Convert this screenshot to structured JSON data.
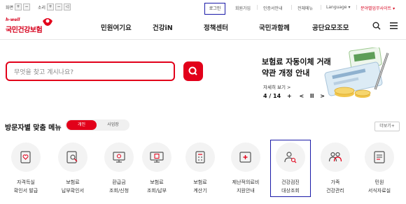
{
  "utility": {
    "screen_label": "화면",
    "sound_label": "소리",
    "plus": "+",
    "minus": "−",
    "links": [
      "로그인",
      "회원가입",
      "인증서안내",
      "전체메뉴"
    ],
    "language": "Language ▾",
    "sitemap": "분야별업무사이트 ▾"
  },
  "logo": {
    "tag": "h-well",
    "name": "국민건강보험"
  },
  "nav": [
    "민원여기요",
    "건강iN",
    "정책센터",
    "국민과함께",
    "공단요모조모"
  ],
  "search": {
    "placeholder": "무엇을 찾고 계시나요?"
  },
  "banner": {
    "line1": "보험료 자동이체 거래",
    "line2": "약관 개정 안내",
    "more": "자세히 보기 >",
    "counter": "4 / 14"
  },
  "section": {
    "title": "방문자별 맞춤 메뉴",
    "tab_individual": "개인",
    "tab_business": "사업장",
    "more": "더보기+"
  },
  "menu": [
    {
      "l1": "자격득실",
      "l2": "확인서 발급"
    },
    {
      "l1": "보험료",
      "l2": "납부확인서"
    },
    {
      "l1": "환급금",
      "l2": "조회/신청"
    },
    {
      "l1": "보험료",
      "l2": "조회/납부"
    },
    {
      "l1": "보험료",
      "l2": "계산기"
    },
    {
      "l1": "제난적의료비",
      "l2": "지원안내"
    },
    {
      "l1": "건강검진",
      "l2": "대상조회"
    },
    {
      "l1": "가족",
      "l2": "건강관리"
    },
    {
      "l1": "민원",
      "l2": "서식자료실"
    }
  ],
  "colors": {
    "accent": "#e2001a",
    "highlight": "#1a1aa8"
  }
}
